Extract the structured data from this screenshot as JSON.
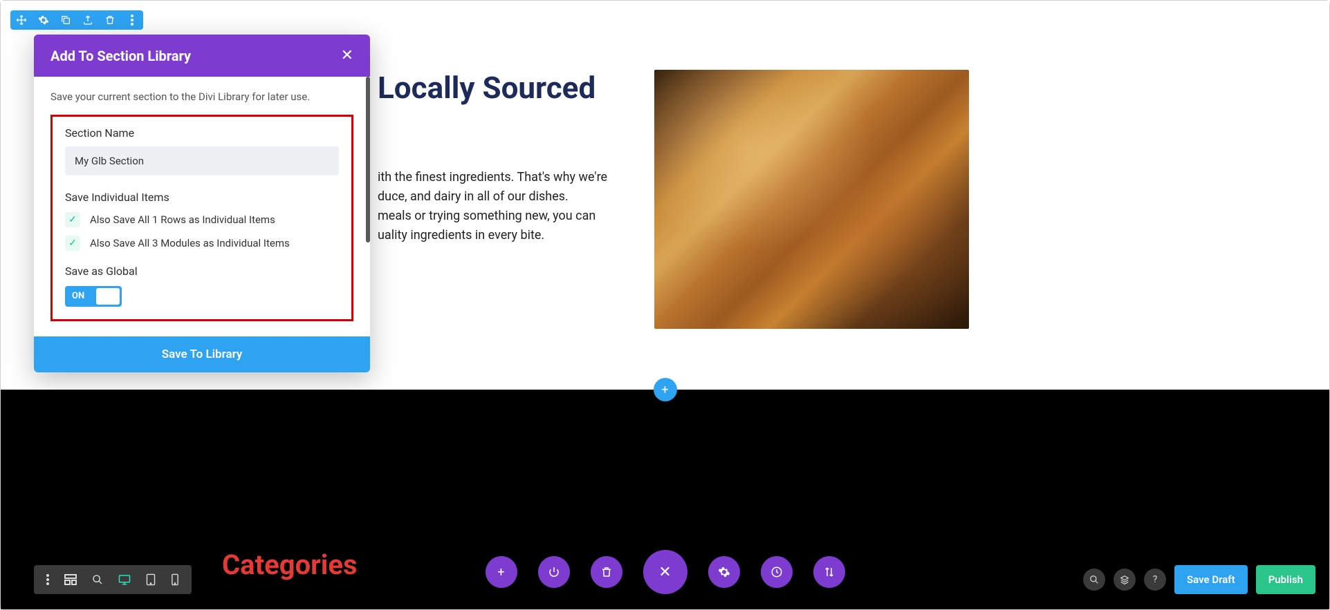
{
  "modal": {
    "title": "Add To Section Library",
    "intro": "Save your current section to the Divi Library for later use.",
    "section_name_label": "Section Name",
    "section_name_value": "My Glb Section",
    "save_individual_label": "Save Individual Items",
    "check_rows": "Also Save All 1 Rows as Individual Items",
    "check_modules": "Also Save All 3 Modules as Individual Items",
    "save_global_label": "Save as Global",
    "toggle_state": "ON",
    "action_label": "Save To Library"
  },
  "page": {
    "hero_title": "Locally Sourced",
    "hero_body_1": "ith the finest ingredients. That's why we're",
    "hero_body_2": "duce, and dairy in all of our dishes.",
    "hero_body_3": "meals or trying something new, you can",
    "hero_body_4": "uality ingredients in every bite.",
    "categories_title": "Categories"
  },
  "bottom_right": {
    "save_draft": "Save Draft",
    "publish": "Publish"
  }
}
